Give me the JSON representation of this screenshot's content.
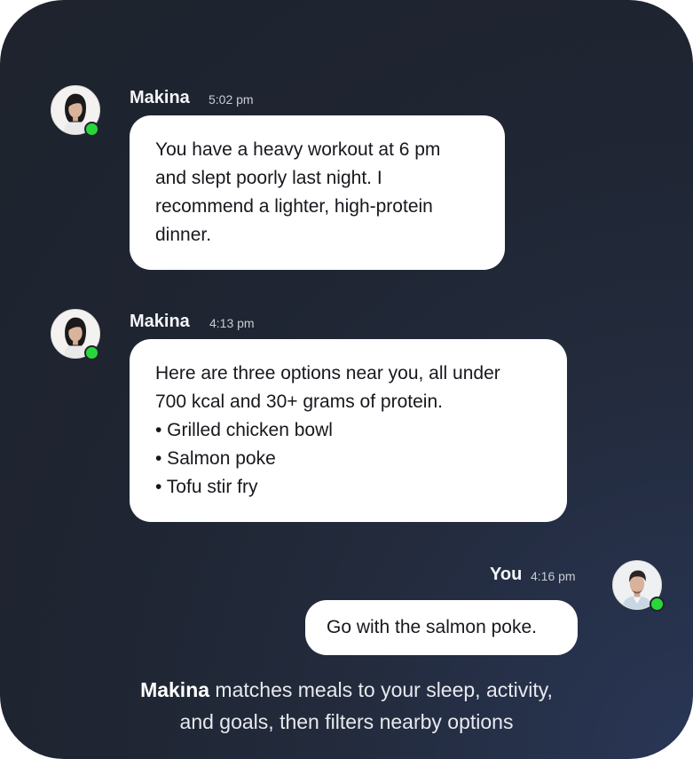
{
  "messages": [
    {
      "sender": "Makina",
      "time": "5:02 pm",
      "lines": [
        "You have a heavy workout at 6 pm",
        "and slept poorly last night. I",
        "recommend a lighter, high-protein",
        "dinner."
      ]
    },
    {
      "sender": "Makina",
      "time": "4:13 pm",
      "lines": [
        "Here are three options near you, all under",
        "700 kcal and 30+ grams of protein.",
        "• Grilled chicken bowl",
        "• Salmon poke",
        "• Tofu stir fry"
      ]
    },
    {
      "sender": "You",
      "time": "4:16 pm",
      "lines": [
        "Go with the salmon poke."
      ]
    }
  ],
  "caption": {
    "brand": "Makina",
    "line1_rest": " matches meals to your sleep, activity,",
    "line2": "and goals, then filters nearby options"
  },
  "colors": {
    "online_status": "#28d73a",
    "card_background": "#1e232d",
    "bubble_background": "#ffffff"
  },
  "icons": {
    "assistant_avatar": "woman-portrait-avatar",
    "user_avatar": "man-portrait-avatar",
    "status": "online-dot"
  }
}
